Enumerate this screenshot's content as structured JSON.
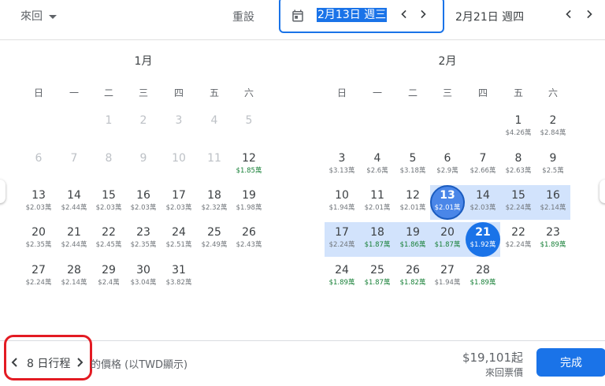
{
  "header": {
    "trip_type": "來回",
    "reset_label": "重設",
    "departure_value": "2月13日 週三",
    "return_value": "2月21日 週四"
  },
  "weekdays": [
    "日",
    "一",
    "二",
    "三",
    "四",
    "五",
    "六"
  ],
  "months": [
    {
      "title": "1月",
      "days": [
        {
          "d": "1",
          "p": "",
          "disabled": true
        },
        {
          "d": "2",
          "p": "",
          "disabled": true
        },
        {
          "d": "3",
          "p": "",
          "disabled": true
        },
        {
          "d": "4",
          "p": "",
          "disabled": true
        },
        {
          "d": "5",
          "p": "",
          "disabled": true
        },
        {
          "d": "6",
          "p": "",
          "disabled": true
        },
        {
          "d": "7",
          "p": "",
          "disabled": true
        },
        {
          "d": "8",
          "p": "",
          "disabled": true
        },
        {
          "d": "9",
          "p": "",
          "disabled": true
        },
        {
          "d": "10",
          "p": "",
          "disabled": true
        },
        {
          "d": "11",
          "p": "",
          "disabled": true
        },
        {
          "d": "12",
          "p": "$1.85萬",
          "low": true
        },
        {
          "d": "13",
          "p": "$2.03萬"
        },
        {
          "d": "14",
          "p": "$2.44萬"
        },
        {
          "d": "15",
          "p": "$2.03萬"
        },
        {
          "d": "16",
          "p": "$2.03萬"
        },
        {
          "d": "17",
          "p": "$2.03萬"
        },
        {
          "d": "18",
          "p": "$2.32萬"
        },
        {
          "d": "19",
          "p": "$1.98萬"
        },
        {
          "d": "20",
          "p": "$2.35萬"
        },
        {
          "d": "21",
          "p": "$2.44萬"
        },
        {
          "d": "22",
          "p": "$2.45萬"
        },
        {
          "d": "23",
          "p": "$2.35萬"
        },
        {
          "d": "24",
          "p": "$2.51萬"
        },
        {
          "d": "25",
          "p": "$2.49萬"
        },
        {
          "d": "26",
          "p": "$2.43萬"
        },
        {
          "d": "27",
          "p": "$2.24萬"
        },
        {
          "d": "28",
          "p": "$2.14萬"
        },
        {
          "d": "29",
          "p": "$2.4萬"
        },
        {
          "d": "30",
          "p": "$3.04萬"
        },
        {
          "d": "31",
          "p": "$3.82萬"
        }
      ]
    },
    {
      "title": "2月",
      "days": [
        {
          "d": "1",
          "p": "$4.26萬"
        },
        {
          "d": "2",
          "p": "$2.84萬"
        },
        {
          "d": "3",
          "p": "$3.13萬"
        },
        {
          "d": "4",
          "p": "$2.6萬"
        },
        {
          "d": "5",
          "p": "$3.18萬"
        },
        {
          "d": "6",
          "p": "$2.9萬"
        },
        {
          "d": "7",
          "p": "$2.66萬"
        },
        {
          "d": "8",
          "p": "$2.63萬"
        },
        {
          "d": "9",
          "p": "$2.5萬"
        },
        {
          "d": "10",
          "p": "$1.94萬"
        },
        {
          "d": "11",
          "p": "$2.01萬"
        },
        {
          "d": "12",
          "p": "$2.01萬"
        },
        {
          "d": "13",
          "p": "$2.01萬",
          "selected": "start"
        },
        {
          "d": "14",
          "p": "$2.03萬",
          "range": true
        },
        {
          "d": "15",
          "p": "$2.24萬",
          "range": true
        },
        {
          "d": "16",
          "p": "$2.14萬",
          "range": true
        },
        {
          "d": "17",
          "p": "$2.24萬",
          "range": true
        },
        {
          "d": "18",
          "p": "$1.87萬",
          "low": true,
          "range": true
        },
        {
          "d": "19",
          "p": "$1.86萬",
          "low": true,
          "range": true
        },
        {
          "d": "20",
          "p": "$1.87萬",
          "low": true,
          "range": true
        },
        {
          "d": "21",
          "p": "$1.92萬",
          "selected": "end"
        },
        {
          "d": "22",
          "p": "$2.24萬"
        },
        {
          "d": "23",
          "p": "$1.89萬",
          "low": true
        },
        {
          "d": "24",
          "p": "$1.89萬",
          "low": true
        },
        {
          "d": "25",
          "p": "$1.87萬",
          "low": true
        },
        {
          "d": "26",
          "p": "$1.82萬",
          "low": true
        },
        {
          "d": "27",
          "p": "$1.94萬"
        },
        {
          "d": "28",
          "p": "$1.89萬",
          "low": true
        }
      ]
    }
  ],
  "footer": {
    "duration_label": "8 日行程",
    "price_note": "的價格 (以TWD顯示)",
    "total_amount": "$19,101起",
    "total_label": "來回票價",
    "done_label": "完成"
  },
  "colors": {
    "accent": "#1a73e8",
    "range": "#d2e3fc",
    "low_price": "#188038",
    "highlight_outline": "#e31b23"
  }
}
